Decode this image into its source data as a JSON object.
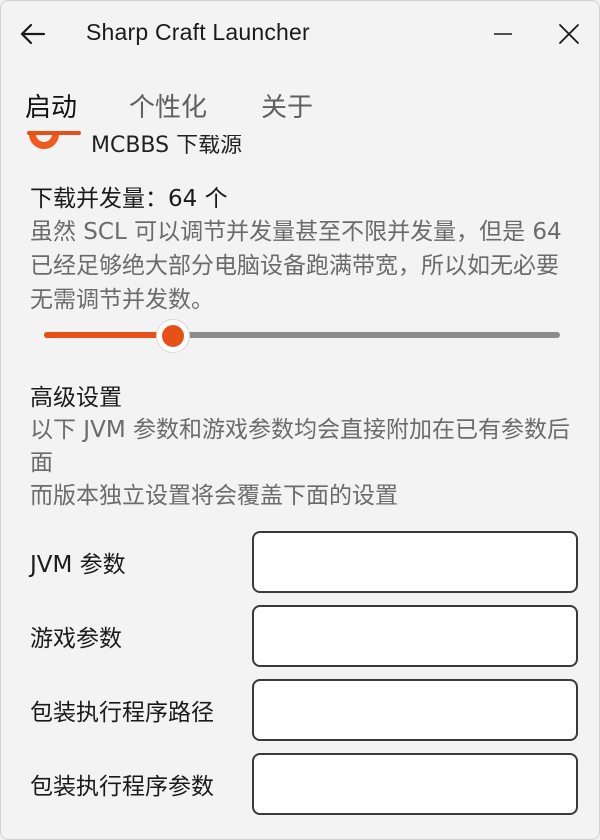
{
  "titlebar": {
    "title": "Sharp Craft Launcher",
    "back_icon": "arrow-left-icon",
    "minimize_icon": "minimize-icon",
    "close_icon": "close-icon"
  },
  "tabs": [
    {
      "label": "启动",
      "active": true
    },
    {
      "label": "个性化",
      "active": false
    },
    {
      "label": "关于",
      "active": false
    }
  ],
  "download_source": {
    "label": "MCBBS 下载源",
    "selected": true
  },
  "concurrency": {
    "label": "下载并发量：64 个",
    "description": "虽然 SCL 可以调节并发量甚至不限并发量，但是 64 已经足够绝大部分电脑设备跑满带宽，所以如无必要无需调节并发数。",
    "slider_value_fraction": 0.25
  },
  "advanced": {
    "title": "高级设置",
    "description_line1": "以下 JVM 参数和游戏参数均会直接附加在已有参数后面",
    "description_line2": "而版本独立设置将会覆盖下面的设置"
  },
  "fields": [
    {
      "label": "JVM 参数",
      "value": ""
    },
    {
      "label": "游戏参数",
      "value": ""
    },
    {
      "label": "包装执行程序路径",
      "value": ""
    },
    {
      "label": "包装执行程序参数",
      "value": ""
    }
  ],
  "colors": {
    "accent": "#e8501a",
    "background": "#f3f3f3"
  }
}
